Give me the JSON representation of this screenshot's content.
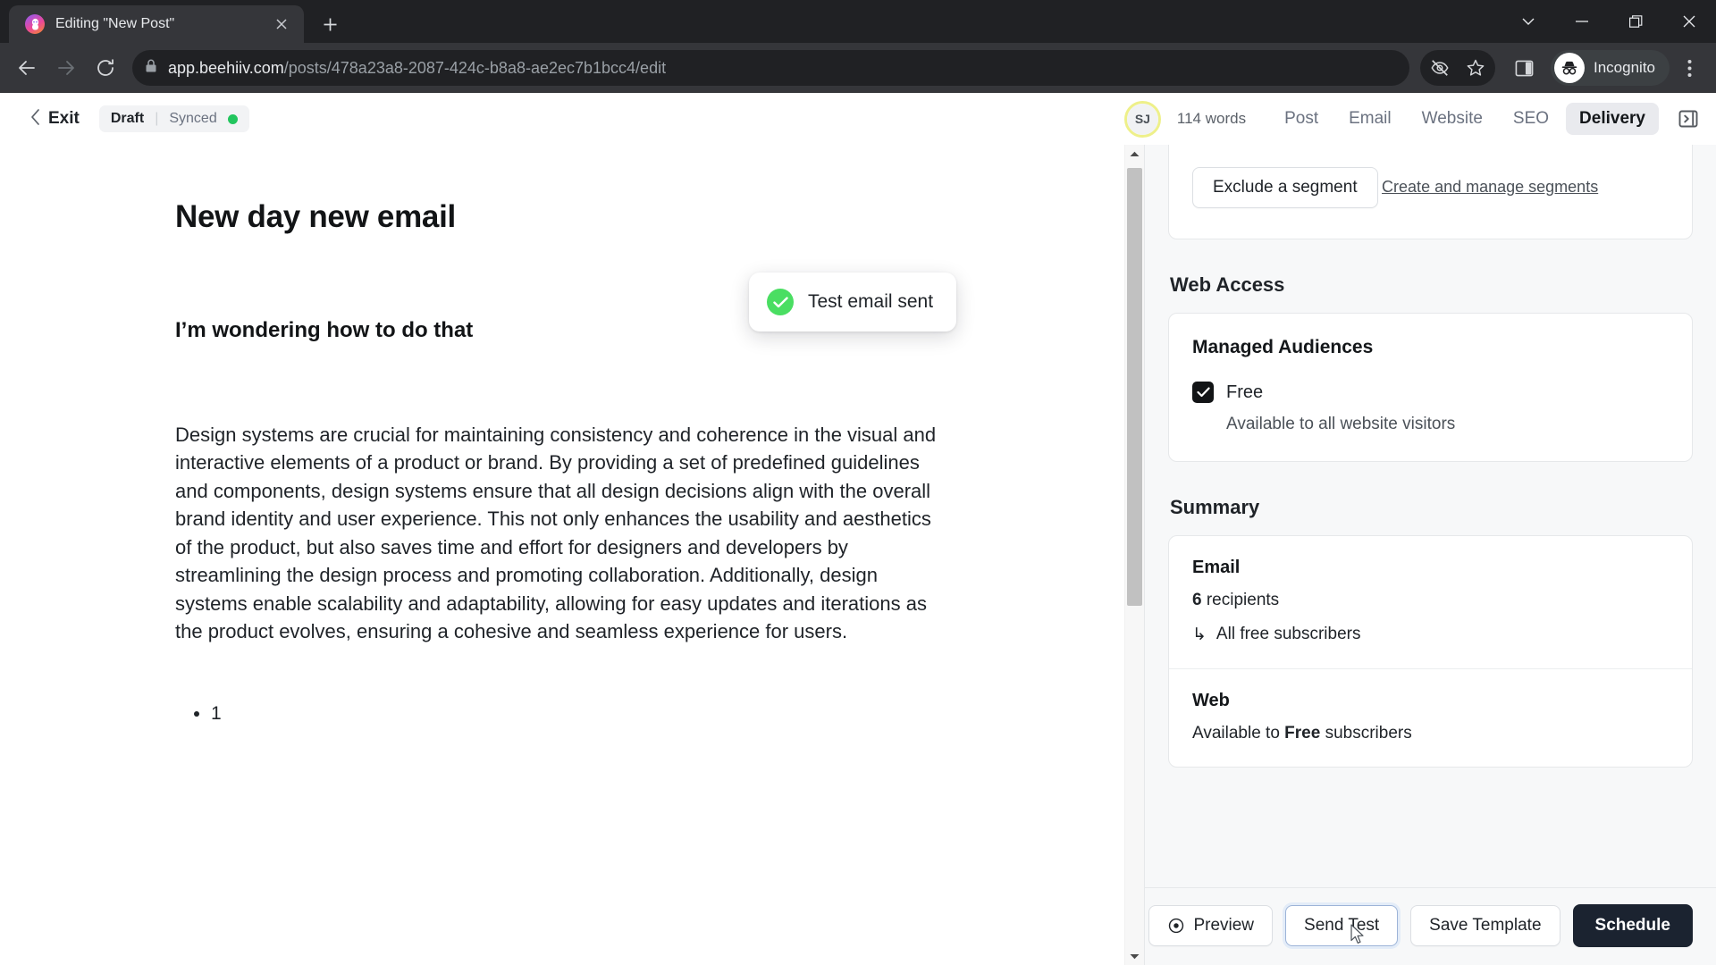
{
  "browser": {
    "tab": {
      "title": "Editing \"New Post\"",
      "favicon": "beehiiv-logo-icon",
      "close": "close-icon"
    },
    "new_tab": "+",
    "window_controls": [
      "tab-search-icon",
      "minimize-icon",
      "maximize-icon",
      "close-icon"
    ],
    "nav": {
      "back": "back-arrow-icon",
      "forward": "forward-arrow-icon",
      "reload": "reload-icon"
    },
    "omnibox": {
      "lock": "lock-icon",
      "domain": "app.beehiiv.com",
      "path": "/posts/478a23a8-2087-424c-b8a8-ae2ec7b1bcc4/edit",
      "full_url": "app.beehiiv.com/posts/478a23a8-2087-424c-b8a8-ae2ec7b1bcc4/edit"
    },
    "toolbar_right": {
      "tracking_protection": "eye-off-icon",
      "bookmark": "star-icon",
      "side_panel": "side-panel-icon",
      "profile_label": "Incognito",
      "profile_icon": "incognito-hat-icon",
      "menu": "three-dot-menu-icon"
    }
  },
  "header": {
    "exit_label": "Exit",
    "exit_chevron": "chevron-left-icon",
    "status": {
      "draft": "Draft",
      "separator": "|",
      "synced": "Synced",
      "dot_color": "#22c55e"
    },
    "avatar_initials": "SJ",
    "avatar_ring_color": "#eef08a",
    "word_count": "114 words",
    "tabs": [
      {
        "label": "Post",
        "active": false
      },
      {
        "label": "Email",
        "active": false
      },
      {
        "label": "Website",
        "active": false
      },
      {
        "label": "SEO",
        "active": false
      },
      {
        "label": "Delivery",
        "active": true
      }
    ],
    "panel_toggle_icon": "collapse-panel-icon"
  },
  "toast": {
    "message": "Test email sent",
    "icon": "check-circle-icon",
    "icon_color": "#4ade62"
  },
  "editor": {
    "title": "New day new email",
    "subheading": "I’m wondering how to do that",
    "paragraph": "Design systems are crucial for maintaining consistency and coherence in the visual and interactive elements of a product or brand. By providing a set of predefined guidelines and components, design systems ensure that all design decisions align with the overall brand identity and user experience. This not only enhances the usability and aesthetics of the product, but also saves time and effort for designers and developers by streamlining the design process and promoting collaboration. Additionally, design systems enable scalability and adaptability, allowing for easy updates and iterations as the product evolves, ensuring a cohesive and seamless experience for users.",
    "list_items": [
      "1"
    ]
  },
  "sidebar": {
    "segments": {
      "exclude_button": "Exclude a segment",
      "manage_link": "Create and manage segments"
    },
    "web_access": {
      "section_title": "Web Access",
      "card_title": "Managed Audiences",
      "checkbox_label": "Free",
      "checkbox_checked": true,
      "checkbox_sub": "Available to all website visitors"
    },
    "summary": {
      "section_title": "Summary",
      "email": {
        "title": "Email",
        "recipients_count": "6",
        "recipients_word": "recipients",
        "detail_arrow": "↳",
        "detail": "All free subscribers"
      },
      "web": {
        "title": "Web",
        "line_prefix": "Available to",
        "line_bold": "Free",
        "line_suffix": "subscribers"
      }
    },
    "footer": {
      "preview": {
        "label": "Preview",
        "icon": "eye-preview-icon"
      },
      "send_test": {
        "label": "Send Test",
        "focused": true
      },
      "save_template": {
        "label": "Save Template"
      },
      "schedule": {
        "label": "Schedule",
        "color": "#1b2330"
      }
    }
  }
}
